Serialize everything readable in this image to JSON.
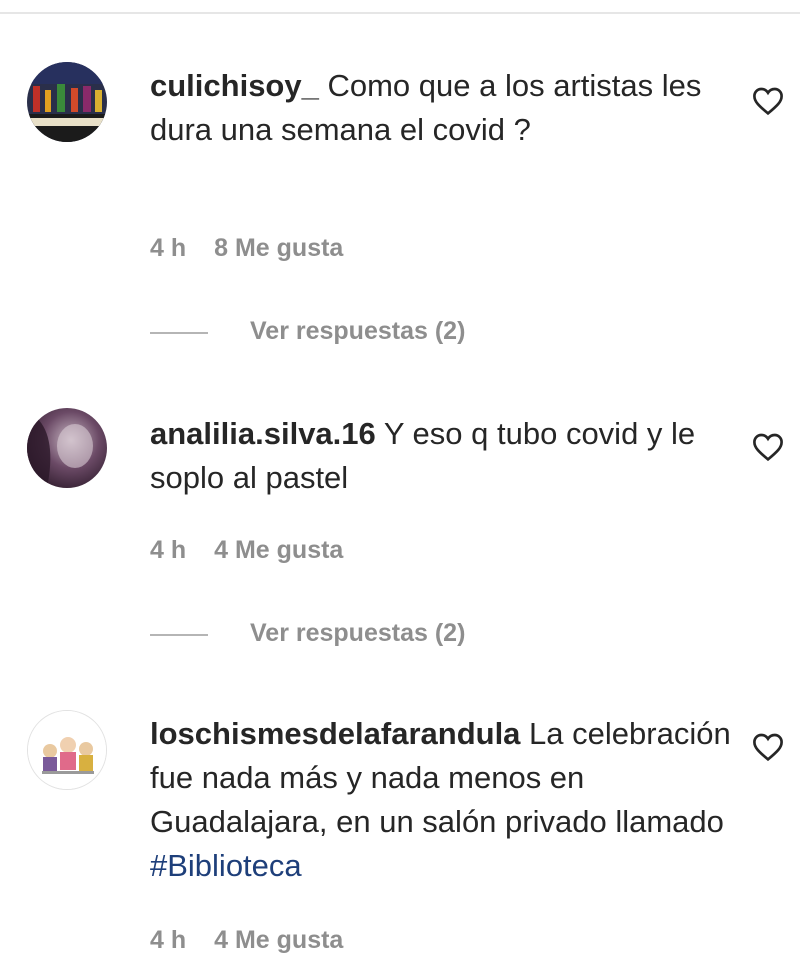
{
  "comments": [
    {
      "username": "culichisoy_",
      "text": " Como que a los artistas les dura una semana el covid ?",
      "time": "4 h",
      "likes": "8 Me gusta",
      "replies_label": "Ver respuestas (2)"
    },
    {
      "username": "analilia.silva.16",
      "text": " Y eso q tubo covid y le soplo al pastel",
      "time": "4 h",
      "likes": "4 Me gusta",
      "replies_label": "Ver respuestas (2)"
    },
    {
      "username": "loschismesdelafarandula",
      "text": " La celebración fue nada más y nada menos en Guadalajara, en un salón privado llamado ",
      "hashtag": "#Biblioteca",
      "time": "4 h",
      "likes": "4 Me gusta"
    }
  ],
  "colors": {
    "text": "#262626",
    "meta": "#8e8e8e",
    "hashtag": "#1e3f7a"
  },
  "icons": {
    "like": "heart-outline-icon"
  }
}
